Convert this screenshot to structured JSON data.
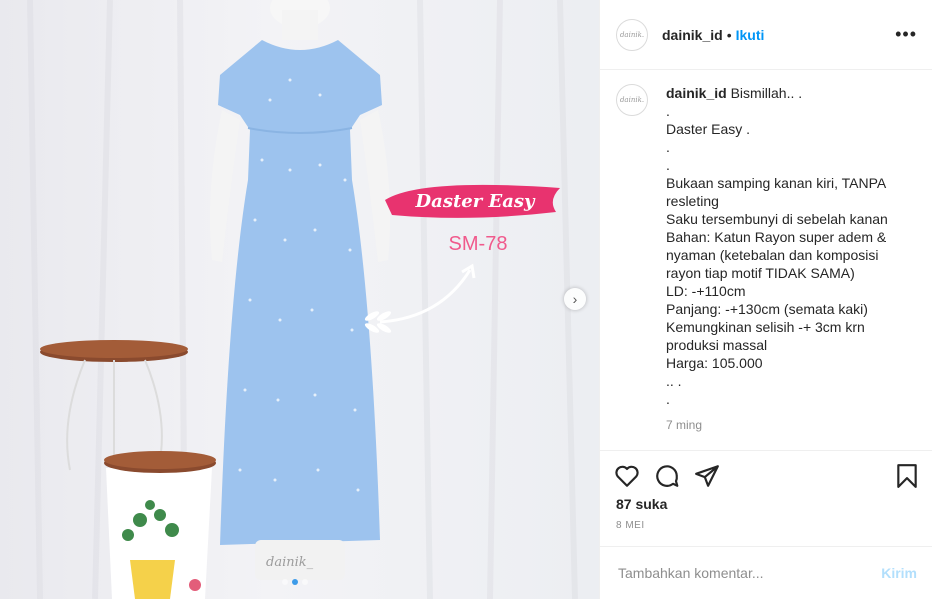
{
  "post": {
    "username": "dainik_id",
    "follow_label": "Ikuti",
    "dot": "•",
    "more_label": "•••",
    "avatar_text": "dainik.",
    "caption_username": "dainik_id",
    "caption_lines": [
      "Bismillah.. .",
      ".",
      "Daster Easy .",
      ".",
      ".",
      "Bukaan samping kanan kiri, TANPA resleting",
      "Saku tersembunyi di sebelah kanan",
      "Bahan: Katun Rayon super adem & nyaman (ketebalan dan komposisi rayon tiap motif TIDAK SAMA)",
      "LD: -+110cm",
      "Panjang: -+130cm (semata kaki)",
      "Kemungkinan selisih -+ 3cm krn produksi massal",
      "Harga: 105.000",
      ".. .",
      "."
    ],
    "time_ago": "7 ming",
    "likes": "87 suka",
    "date": "8 MEI",
    "comment_placeholder": "Tambahkan komentar...",
    "post_label": "Kirim"
  },
  "media": {
    "overlay_title": "Daster Easy",
    "overlay_code": "SM-78",
    "watermark": "dainik_",
    "next_icon": "chevron-right-icon",
    "carousel_dots": 3,
    "active_dot": 1
  },
  "colors": {
    "accent": "#0095f6",
    "dress": "#9dc3ee",
    "pink": "#f05a8c",
    "wood": "#8a4a2e"
  }
}
